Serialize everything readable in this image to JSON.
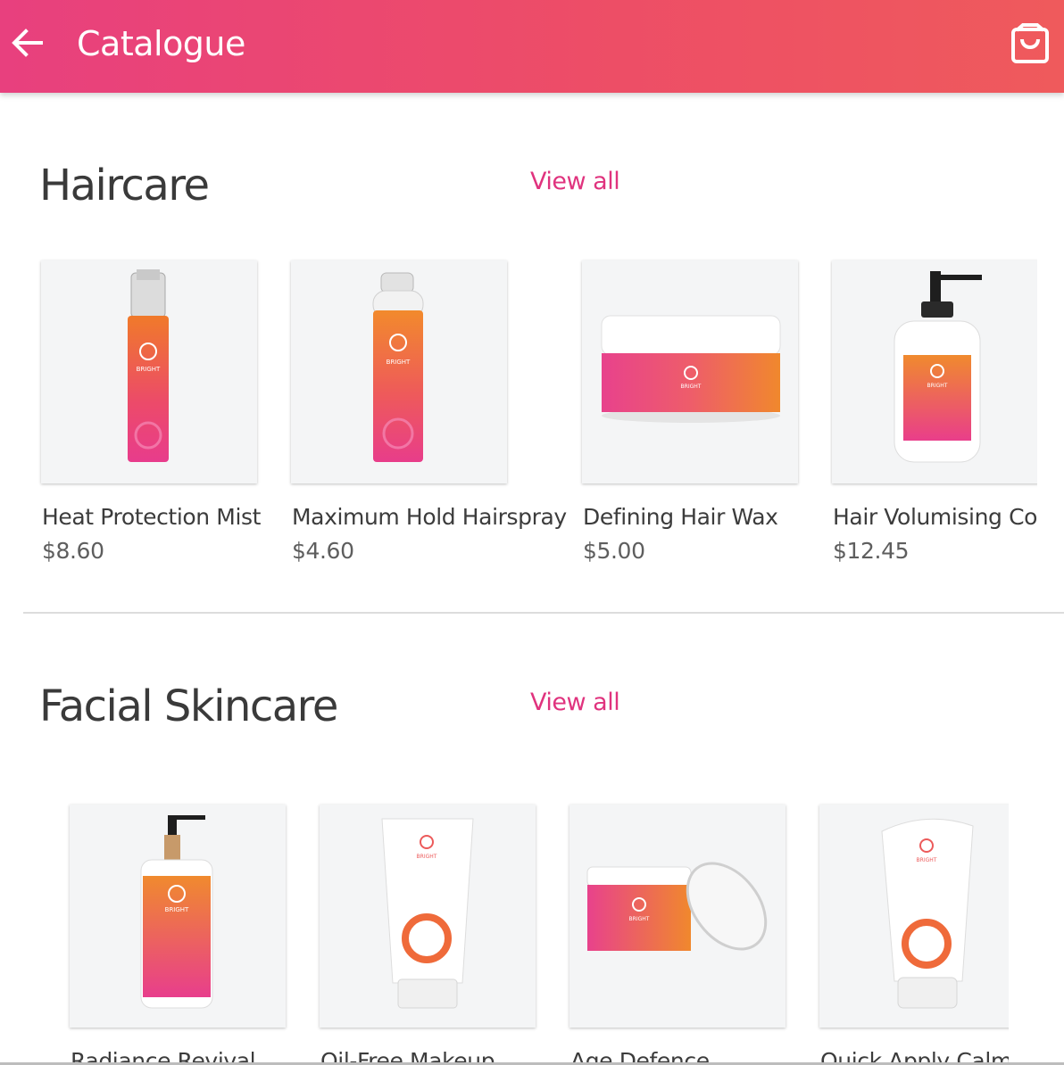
{
  "appbar": {
    "title": "Catalogue",
    "back_icon": "arrow-left-icon",
    "cart_icon": "shopping-bag-icon",
    "color_start": "#e8407e",
    "color_end": "#ef5a5c"
  },
  "sections": [
    {
      "title": "Haircare",
      "view_all": "View all",
      "products": [
        {
          "name": "Heat Protection Mist",
          "price": "$8.60",
          "image": "spray-bottle"
        },
        {
          "name": "Maximum Hold Hairspray",
          "price": "$4.60",
          "image": "aerosol-can"
        },
        {
          "name": "Defining Hair Wax",
          "price": "$5.00",
          "image": "wax-tub"
        },
        {
          "name": "Hair Volumising Con",
          "price": "$12.45",
          "image": "pump-bottle"
        }
      ]
    },
    {
      "title": "Facial Skincare",
      "view_all": "View all",
      "products": [
        {
          "name": "Radiance Revival",
          "image": "pump-bottle-tall"
        },
        {
          "name": "Oil-Free Makeup",
          "image": "tube"
        },
        {
          "name": "Age Defence",
          "image": "open-jar"
        },
        {
          "name": "Quick Apply Calmir",
          "image": "squeeze-tube"
        }
      ]
    }
  ],
  "accent_color": "#e0337e"
}
